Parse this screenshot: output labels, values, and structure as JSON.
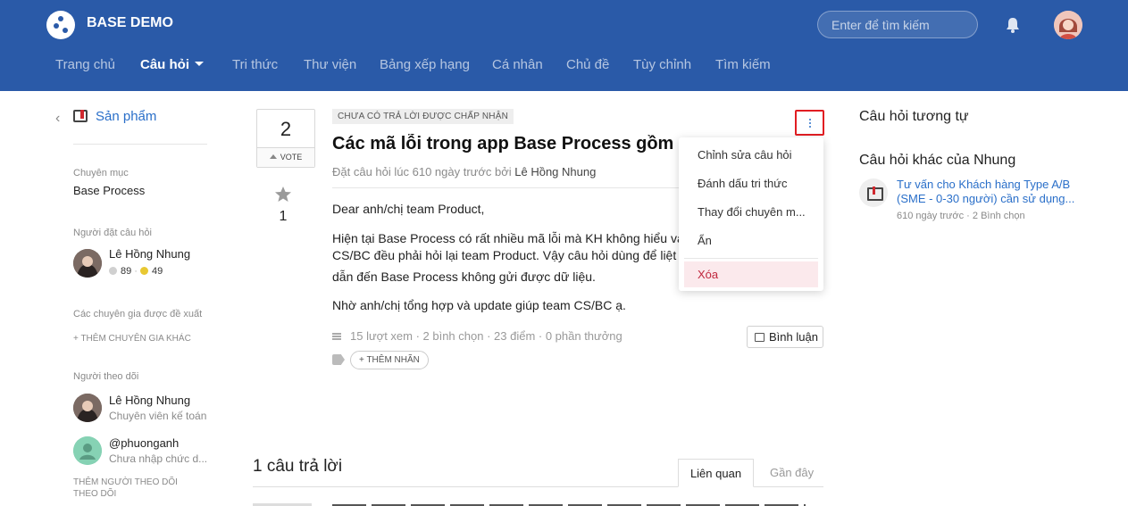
{
  "header": {
    "brand": "BASE DEMO",
    "search_placeholder": "Enter để tìm kiếm",
    "nav": [
      "Trang chủ",
      "Câu hỏi",
      "Tri thức",
      "Thư viện",
      "Bảng xếp hạng",
      "Cá nhân",
      "Chủ đề",
      "Tùy chỉnh",
      "Tìm kiếm"
    ],
    "active_nav": "Câu hỏi",
    "color": "#2a5aa8"
  },
  "sidebar": {
    "category": "Sản phẩm",
    "topic_heading": "Chuyên mục",
    "topic_value": "Base Process",
    "asker_heading": "Người đặt câu hỏi",
    "asker_name": "Lê Hồng Nhung",
    "asker_silver": "89",
    "asker_gold": "49",
    "experts_heading": "Các chuyên gia được đề xuất",
    "add_expert": "+ THÊM CHUYÊN GIA KHÁC",
    "followers_heading": "Người theo dõi",
    "followers": [
      {
        "name": "Lê Hồng Nhung",
        "sub": "Chuyên viên kế toán"
      },
      {
        "name": "@phuonganh",
        "sub": "Chưa nhập chức d..."
      }
    ],
    "add_follower": "THÊM NGƯỜI THEO DÕI THEO DÕI"
  },
  "vote": {
    "count": "2",
    "label": "VOTE",
    "stars": "1"
  },
  "question": {
    "badge": "CHƯA CÓ TRẢ LỜI ĐƯỢC CHẤP NHẬN",
    "title": "Các mã lỗi trong app Base Process gồm nhữ",
    "meta_prefix": "Đặt câu hỏi lúc 610 ngày trước bởi",
    "author": "Lê Hồng Nhung",
    "body": [
      "Dear anh/chị team Product,",
      "Hiện tại Base Process có rất nhiều mã lỗi mà KH không hiểu và",
      "CS/BC đều phải hỏi lại team Product. Vậy câu hỏi dùng để liệt k",
      "dẫn đến Base Process không gửi được dữ liệu.",
      "Nhờ anh/chị tổng hợp và update giúp team CS/BC ạ."
    ],
    "stats": "15 lượt xem · 2 bình chọn · 23 điểm · 0 phần thưởng",
    "comment_button": "Bình luận",
    "add_tag": "+ THÊM NHÃN"
  },
  "menu": {
    "items": [
      "Chỉnh sửa câu hỏi",
      "Đánh dấu tri thức",
      "Thay đổi chuyên m...",
      "Ẩn"
    ],
    "delete": "Xóa"
  },
  "answers": {
    "heading": "1 câu trả lời",
    "tab_related": "Liên quan",
    "tab_recent": "Gần đây"
  },
  "right": {
    "similar_heading": "Câu hỏi tương tự",
    "other_heading": "Câu hỏi khác của Nhung",
    "other_link": "Tư vấn cho Khách hàng Type A/B (SME - 0-30 người) cần sử dụng...",
    "other_meta": "610 ngày trước · 2 Bình chọn"
  }
}
